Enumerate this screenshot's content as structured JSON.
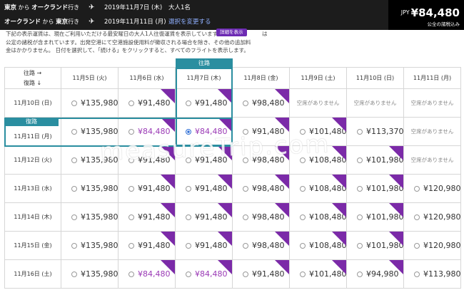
{
  "header": {
    "row1": {
      "from": "東京",
      "from_conn": " から ",
      "to": "オークランド",
      "to_suffix": "行き",
      "plane_icon": "airplane-icon",
      "date": "2019年11月7日 (木)",
      "pax": "大人1名"
    },
    "row2": {
      "from": "オークランド",
      "from_conn": " から ",
      "to": "東京",
      "to_suffix": "行き",
      "plane_icon": "airplane-icon",
      "date": "2019年11月11日 (月)",
      "change_link": "選択を変更する"
    },
    "price": {
      "currency": "JPY",
      "amount": "¥84,480",
      "note": "公全の諸税込み"
    }
  },
  "notice": {
    "line1": "下記の表示運賃は、現在ご利用いただける最安曜日の大人1人往復運賃を表示しています",
    "line1_end": "は",
    "line2": "公定の諸税が含まれています。出発空港にて空港施設使用料が徴収される場合を除き、その他の追加料",
    "line3": "金はかかりません。 日付を選択して、「続ける」をクリックすると、すべてのフライトを表示します。",
    "detail_button": "詳細を表示"
  },
  "grid": {
    "corner_out": "往路 →",
    "corner_ret": "復路 ↓",
    "outbound_label": "往路",
    "return_label": "復路",
    "columns": [
      "11月5日 (火)",
      "11月6日 (水)",
      "11月7日 (木)",
      "11月8日 (金)",
      "11月9日 (土)",
      "11月10日 (日)",
      "11月11日 (月)"
    ],
    "rows": [
      {
        "label": "11月10日 (日)",
        "cells": [
          {
            "t": "price",
            "v": "¥135,980"
          },
          {
            "t": "price",
            "v": "¥91,480",
            "promo_ribbon": true
          },
          {
            "t": "price",
            "v": "¥91,480",
            "promo_ribbon": true
          },
          {
            "t": "price",
            "v": "¥98,480",
            "promo_ribbon": true
          },
          {
            "t": "na",
            "v": "空席がありません"
          },
          {
            "t": "na",
            "v": "空席がありません"
          },
          {
            "t": "na",
            "v": "空席がありません"
          }
        ]
      },
      {
        "label": "11月11日 (月)",
        "cells": [
          {
            "t": "price",
            "v": "¥135,980"
          },
          {
            "t": "price",
            "v": "¥84,480",
            "promo_color": true,
            "promo_ribbon": true
          },
          {
            "t": "price",
            "v": "¥84,480",
            "selected": true,
            "promo_ribbon": true
          },
          {
            "t": "price",
            "v": "¥91,480",
            "promo_ribbon": true
          },
          {
            "t": "price",
            "v": "¥101,480",
            "promo_ribbon": true
          },
          {
            "t": "price",
            "v": "¥113,370"
          },
          {
            "t": "na",
            "v": "空席がありません"
          }
        ]
      },
      {
        "label": "11月12日 (火)",
        "cells": [
          {
            "t": "price",
            "v": "¥135,980"
          },
          {
            "t": "price",
            "v": "¥91,480",
            "promo_ribbon": true
          },
          {
            "t": "price",
            "v": "¥91,480",
            "promo_ribbon": true
          },
          {
            "t": "price",
            "v": "¥98,480",
            "promo_ribbon": true
          },
          {
            "t": "price",
            "v": "¥108,480",
            "promo_ribbon": true
          },
          {
            "t": "price",
            "v": "¥101,980",
            "promo_ribbon": true
          },
          {
            "t": "na",
            "v": "空席がありません"
          }
        ]
      },
      {
        "label": "11月13日 (水)",
        "cells": [
          {
            "t": "price",
            "v": "¥135,980"
          },
          {
            "t": "price",
            "v": "¥91,480",
            "promo_ribbon": true
          },
          {
            "t": "price",
            "v": "¥91,480",
            "promo_ribbon": true
          },
          {
            "t": "price",
            "v": "¥98,480",
            "promo_ribbon": true
          },
          {
            "t": "price",
            "v": "¥108,480",
            "promo_ribbon": true
          },
          {
            "t": "price",
            "v": "¥101,980",
            "promo_ribbon": true
          },
          {
            "t": "price",
            "v": "¥120,980"
          }
        ]
      },
      {
        "label": "11月14日 (木)",
        "cells": [
          {
            "t": "price",
            "v": "¥135,980"
          },
          {
            "t": "price",
            "v": "¥91,480",
            "promo_ribbon": true
          },
          {
            "t": "price",
            "v": "¥91,480",
            "promo_ribbon": true
          },
          {
            "t": "price",
            "v": "¥98,480",
            "promo_ribbon": true
          },
          {
            "t": "price",
            "v": "¥108,480",
            "promo_ribbon": true
          },
          {
            "t": "price",
            "v": "¥101,980",
            "promo_ribbon": true
          },
          {
            "t": "price",
            "v": "¥120,980"
          }
        ]
      },
      {
        "label": "11月15日 (金)",
        "cells": [
          {
            "t": "price",
            "v": "¥135,980"
          },
          {
            "t": "price",
            "v": "¥91,480",
            "promo_ribbon": true
          },
          {
            "t": "price",
            "v": "¥91,480",
            "promo_ribbon": true
          },
          {
            "t": "price",
            "v": "¥98,480",
            "promo_ribbon": true
          },
          {
            "t": "price",
            "v": "¥108,480",
            "promo_ribbon": true
          },
          {
            "t": "price",
            "v": "¥101,980",
            "promo_ribbon": true
          },
          {
            "t": "price",
            "v": "¥120,980"
          }
        ]
      },
      {
        "label": "11月16日 (土)",
        "cells": [
          {
            "t": "price",
            "v": "¥135,980"
          },
          {
            "t": "price",
            "v": "¥84,480",
            "promo_color": true,
            "promo_ribbon": true
          },
          {
            "t": "price",
            "v": "¥84,480",
            "promo_color": true,
            "promo_ribbon": true
          },
          {
            "t": "price",
            "v": "¥91,480",
            "promo_ribbon": true
          },
          {
            "t": "price",
            "v": "¥101,480",
            "promo_ribbon": true
          },
          {
            "t": "price",
            "v": "¥94,980",
            "promo_ribbon": true
          },
          {
            "t": "price",
            "v": "¥113,980"
          }
        ]
      }
    ]
  },
  "watermark": "measureTrip.com",
  "colors": {
    "accent_teal": "#2a8ea0",
    "promo_purple": "#7b2aa8",
    "promo_text": "#9a39b5",
    "header_bg": "#1c1c1c"
  }
}
